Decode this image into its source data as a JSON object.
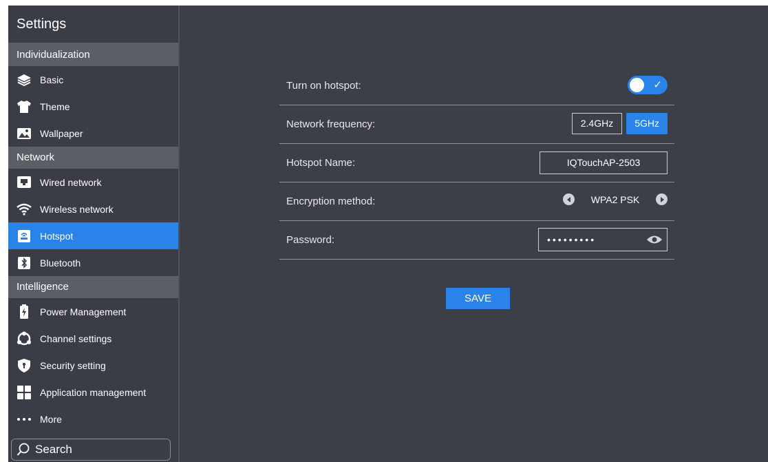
{
  "sidebar": {
    "title": "Settings",
    "sections": [
      {
        "label": "Individualization",
        "items": [
          {
            "label": "Basic",
            "icon": "layers-icon"
          },
          {
            "label": "Theme",
            "icon": "tshirt-icon"
          },
          {
            "label": "Wallpaper",
            "icon": "image-icon"
          }
        ]
      },
      {
        "label": "Network",
        "items": [
          {
            "label": "Wired network",
            "icon": "monitor-icon"
          },
          {
            "label": "Wireless network",
            "icon": "wifi-icon"
          },
          {
            "label": "Hotspot",
            "icon": "hotspot-icon",
            "active": true
          },
          {
            "label": "Bluetooth",
            "icon": "bluetooth-icon"
          }
        ]
      },
      {
        "label": "Intelligence",
        "items": [
          {
            "label": "Power Management",
            "icon": "battery-icon"
          },
          {
            "label": "Channel settings",
            "icon": "channel-icon"
          },
          {
            "label": "Security setting",
            "icon": "shield-icon"
          },
          {
            "label": "Application management",
            "icon": "apps-icon"
          },
          {
            "label": "More",
            "icon": "more-dots-icon"
          }
        ]
      }
    ],
    "search": {
      "label": "Search",
      "icon": "search-icon"
    }
  },
  "hotspot": {
    "turn_on": {
      "label": "Turn on hotspot:",
      "enabled": true
    },
    "frequency": {
      "label": "Network frequency:",
      "options": [
        "2.4GHz",
        "5GHz"
      ],
      "selected": "5GHz"
    },
    "name": {
      "label": "Hotspot Name:",
      "value": "IQTouchAP-2503"
    },
    "encryption": {
      "label": "Encryption method:",
      "value": "WPA2 PSK"
    },
    "password": {
      "label": "Password:",
      "masked": "•••••••••"
    },
    "save_label": "SAVE"
  },
  "colors": {
    "accent": "#2a83e8",
    "background": "#3c3f48",
    "section": "#5a5e66"
  }
}
